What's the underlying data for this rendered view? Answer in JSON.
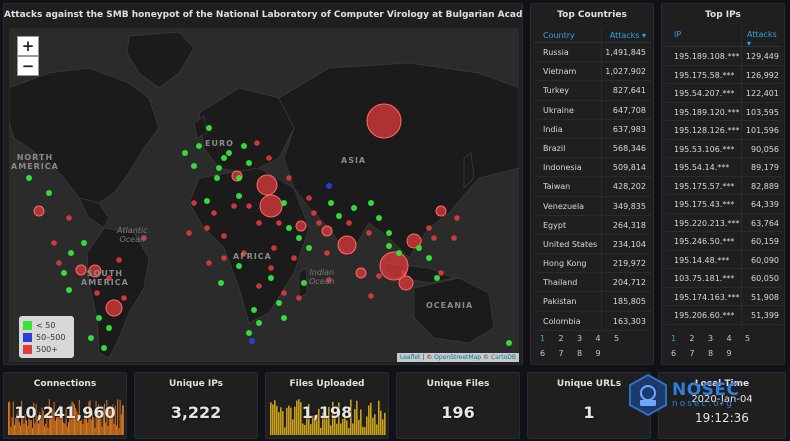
{
  "map": {
    "title": "Attacks against the SMB honeypot of the National Laboratory of Computer Virology at Bulgarian Academy of Sciences",
    "zoom_in": "+",
    "zoom_out": "−",
    "labels": {
      "north_america": "NORTH\nAMERICA",
      "south_america": "SOUTH\nAMERICA",
      "asia": "ASIA",
      "africa": "AFRICA",
      "europe": "EURO",
      "oceania": "OCEANIA",
      "atlantic": "Atlantic\nOcean",
      "indian": "Indian\nOcean"
    },
    "legend": [
      {
        "label": "< 50",
        "color": "#37e53a"
      },
      {
        "label": "50–500",
        "color": "#2b3fd6"
      },
      {
        "label": "500+",
        "color": "#e23b3b"
      }
    ],
    "attribution": {
      "leaflet": "Leaflet",
      "sep1": " | © ",
      "osm": "OpenStreetMap",
      "sep2": " © ",
      "carto": "CartoDB"
    }
  },
  "countries": {
    "title": "Top Countries",
    "col_country": "Country",
    "col_attacks": "Attacks ▾",
    "rows": [
      {
        "name": "Russia",
        "attacks": "1,491,845"
      },
      {
        "name": "Vietnam",
        "attacks": "1,027,902"
      },
      {
        "name": "Turkey",
        "attacks": "827,641"
      },
      {
        "name": "Ukraine",
        "attacks": "647,708"
      },
      {
        "name": "India",
        "attacks": "637,983"
      },
      {
        "name": "Brazil",
        "attacks": "568,346"
      },
      {
        "name": "Indonesia",
        "attacks": "509,814"
      },
      {
        "name": "Taiwan",
        "attacks": "428,202"
      },
      {
        "name": "Venezuela",
        "attacks": "349,835"
      },
      {
        "name": "Egypt",
        "attacks": "264,318"
      },
      {
        "name": "United States",
        "attacks": "234,104"
      },
      {
        "name": "Hong Kong",
        "attacks": "219,972"
      },
      {
        "name": "Thailand",
        "attacks": "204,712"
      },
      {
        "name": "Pakistan",
        "attacks": "185,805"
      },
      {
        "name": "Colombia",
        "attacks": "163,303"
      }
    ],
    "pages": [
      "1",
      "2",
      "3",
      "4",
      "5",
      "6",
      "7",
      "8",
      "9"
    ]
  },
  "ips": {
    "title": "Top IPs",
    "col_ip": "IP",
    "col_attacks": "Attacks",
    "sort_arrow": "▾",
    "rows": [
      {
        "ip": "195.189.108.***",
        "attacks": "129,449"
      },
      {
        "ip": "195.175.58.***",
        "attacks": "126,992"
      },
      {
        "ip": "195.54.207.***",
        "attacks": "122,401"
      },
      {
        "ip": "195.189.120.***",
        "attacks": "103,595"
      },
      {
        "ip": "195.128.126.***",
        "attacks": "101,596"
      },
      {
        "ip": "195.53.106.***",
        "attacks": "90,056"
      },
      {
        "ip": "195.54.14.***",
        "attacks": "89,179"
      },
      {
        "ip": "195.175.57.***",
        "attacks": "82,889"
      },
      {
        "ip": "195.175.43.***",
        "attacks": "64,339"
      },
      {
        "ip": "195.220.213.***",
        "attacks": "63,764"
      },
      {
        "ip": "195.246.50.***",
        "attacks": "60,159"
      },
      {
        "ip": "195.14.48.***",
        "attacks": "60,090"
      },
      {
        "ip": "103.75.181.***",
        "attacks": "60,050"
      },
      {
        "ip": "195.174.163.***",
        "attacks": "51,908"
      },
      {
        "ip": "195.206.60.***",
        "attacks": "51,399"
      }
    ],
    "pages": [
      "1",
      "2",
      "3",
      "4",
      "5",
      "6",
      "7",
      "8",
      "9"
    ]
  },
  "stats": {
    "connections": {
      "label": "Connections",
      "value": "10,241,960",
      "color": "#e07a20"
    },
    "unique_ips": {
      "label": "Unique IPs",
      "value": "3,222"
    },
    "files_uploaded": {
      "label": "Files Uploaded",
      "value": "1,198",
      "color": "#c8a01c"
    },
    "unique_files": {
      "label": "Unique Files",
      "value": "196"
    },
    "unique_urls": {
      "label": "Unique URLs",
      "value": "1"
    },
    "local_time": {
      "label": "Local Time",
      "date": "2020-Jan-04",
      "time": "19:12:36"
    }
  },
  "logo": {
    "name": "NOSEC",
    "sub": "nosec.org"
  },
  "colors": {
    "accent": "#33a2e5",
    "green": "#37e53a",
    "blue": "#2b3fd6",
    "red": "#e23b3b"
  }
}
